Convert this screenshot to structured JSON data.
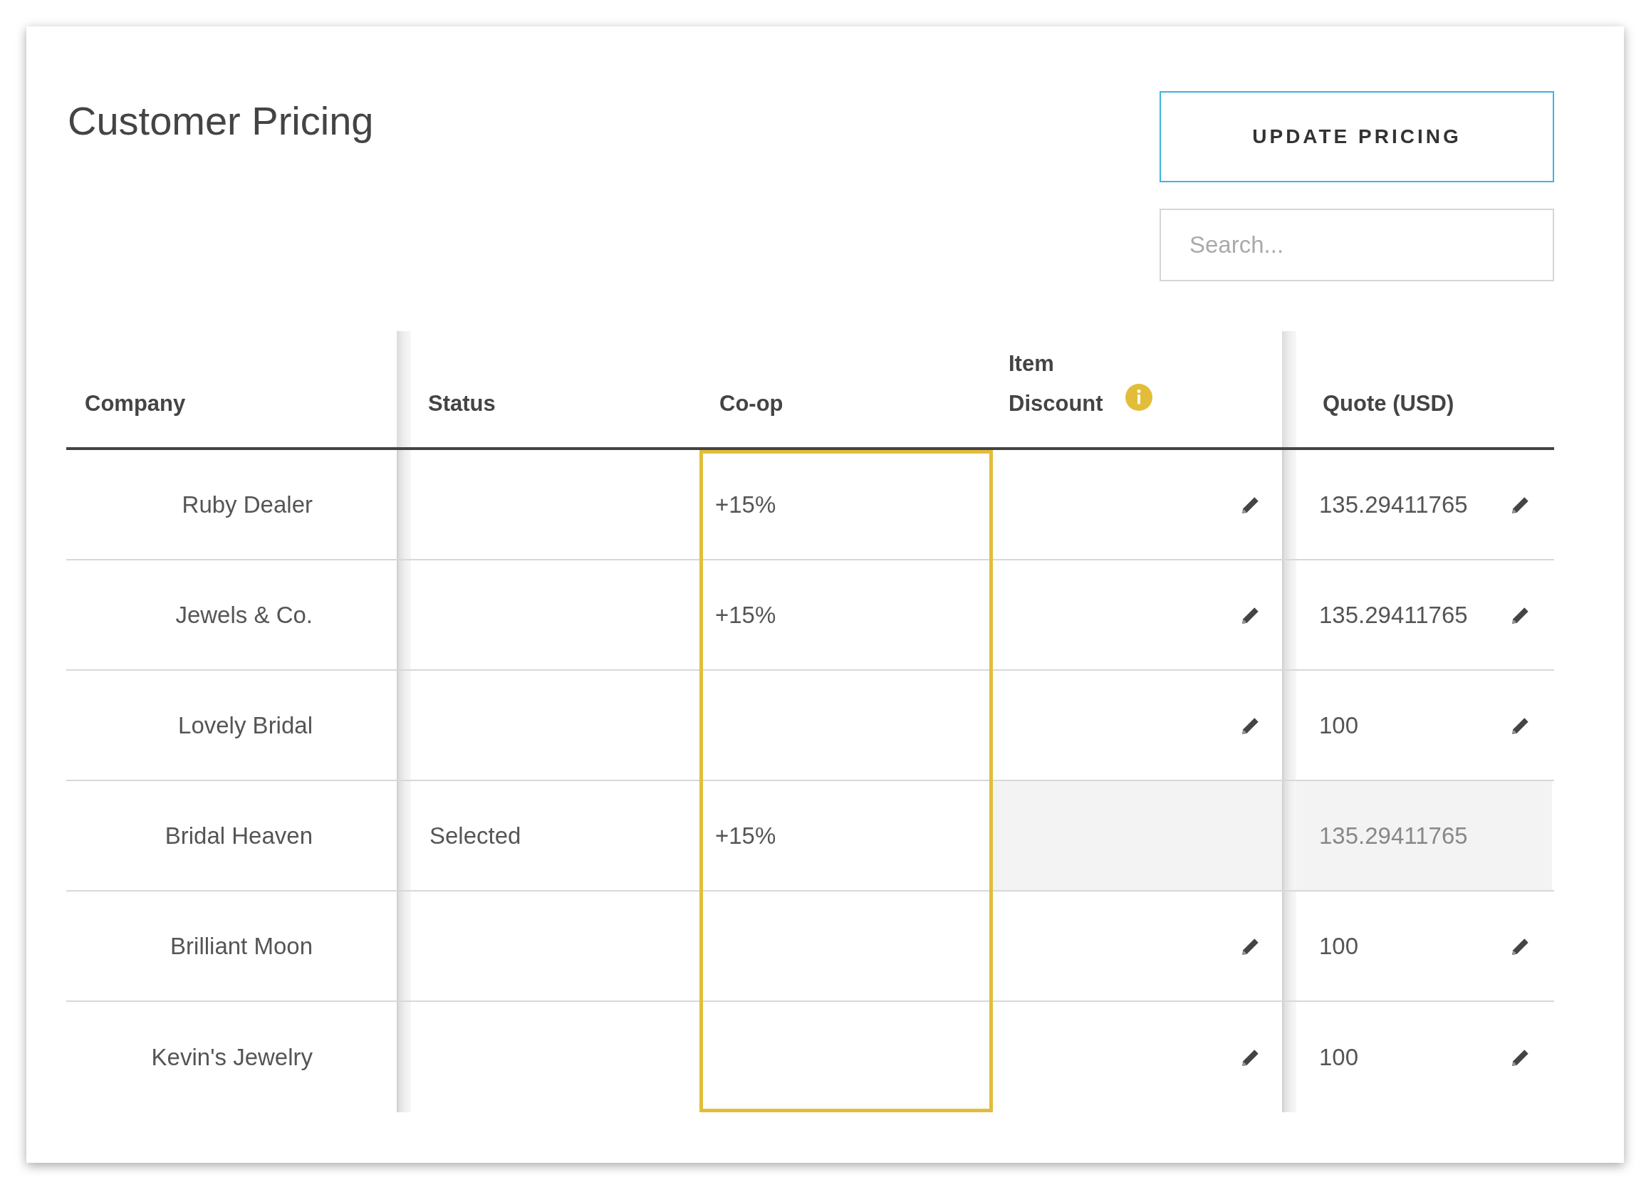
{
  "title": "Customer Pricing",
  "update_button": "UPDATE PRICING",
  "search": {
    "placeholder": "Search..."
  },
  "columns": [
    {
      "label": "Company",
      "highlighted": false
    },
    {
      "label": "Status",
      "highlighted": false
    },
    {
      "label": "Co-op",
      "highlighted": true
    },
    {
      "label": "Item Discount",
      "highlighted": false,
      "info": true
    },
    {
      "label": "Quote (USD)",
      "highlighted": false
    }
  ],
  "rows": [
    {
      "company": "Ruby Dealer",
      "status": "",
      "coop": "+15%",
      "quote": "135.29411765",
      "editable": true
    },
    {
      "company": "Jewels & Co.",
      "status": "",
      "coop": "+15%",
      "quote": "135.29411765",
      "editable": true
    },
    {
      "company": "Lovely Bridal",
      "status": "",
      "coop": "",
      "quote": "100",
      "editable": true
    },
    {
      "company": "Bridal Heaven",
      "status": "Selected",
      "coop": "+15%",
      "quote": "135.29411765",
      "editable": false
    },
    {
      "company": "Brilliant Moon",
      "status": "",
      "coop": "",
      "quote": "100",
      "editable": true
    },
    {
      "company": "Kevin's Jewelry",
      "status": "",
      "coop": "",
      "quote": "100",
      "editable": true
    }
  ]
}
